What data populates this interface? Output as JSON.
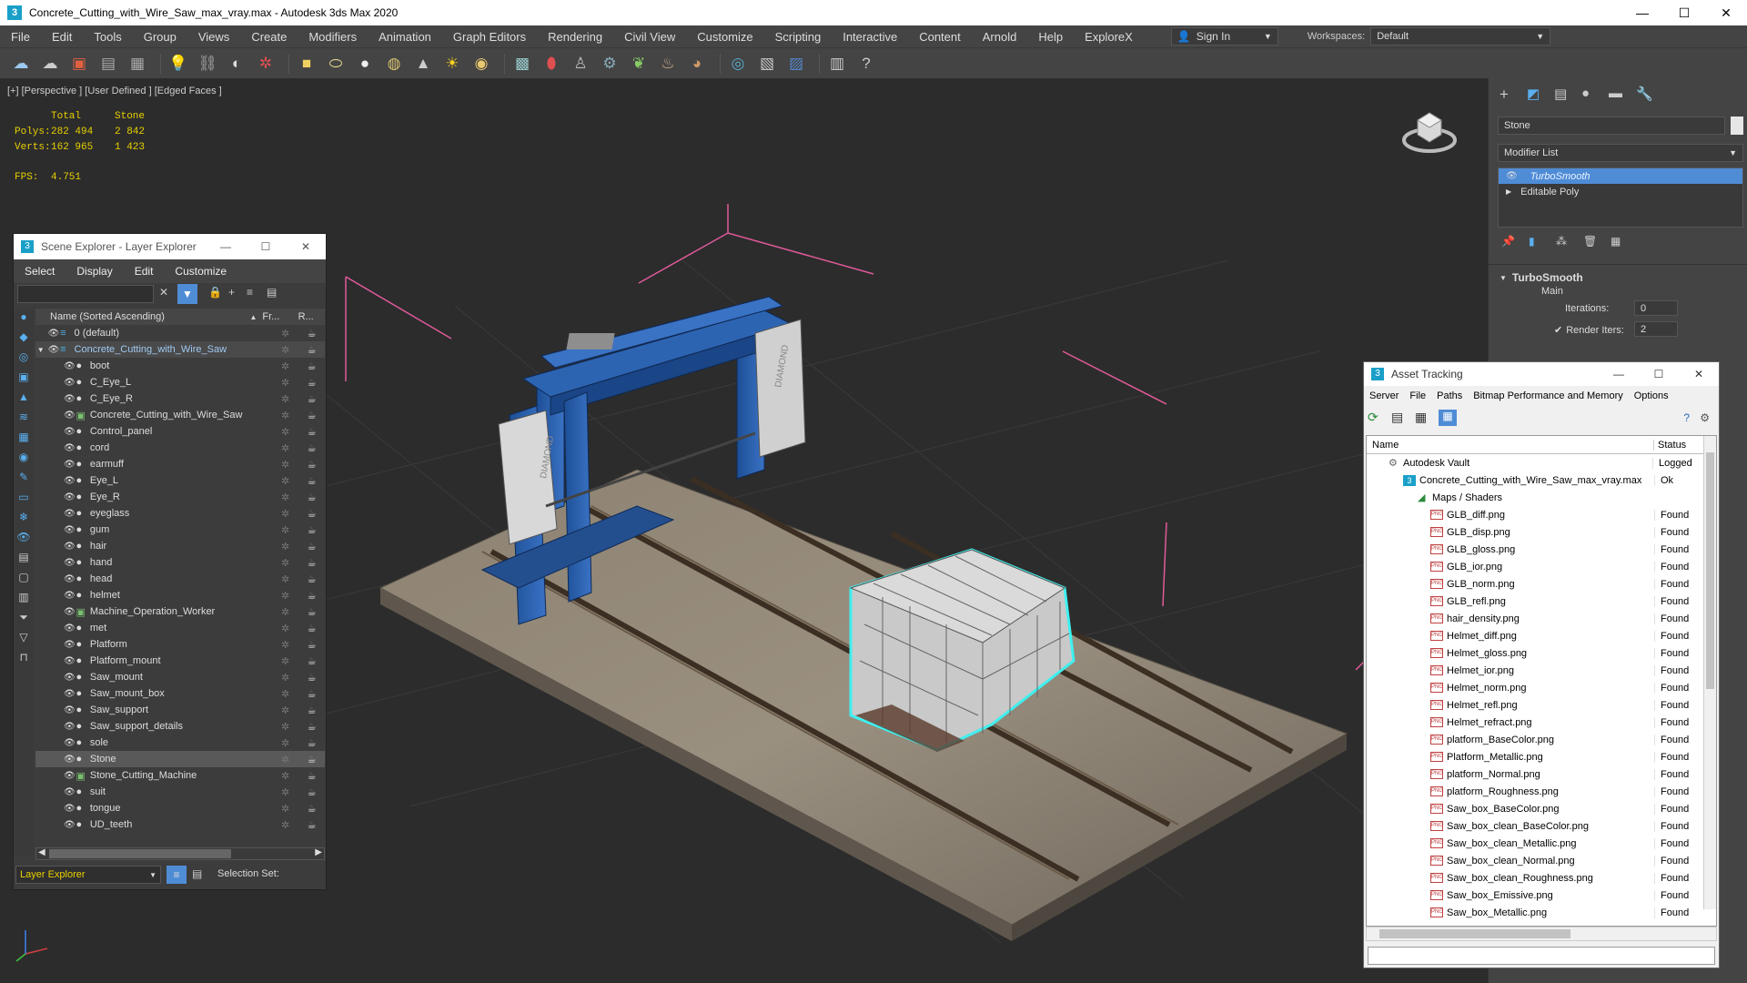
{
  "titlebar": {
    "app_icon": "3",
    "title": "Concrete_Cutting_with_Wire_Saw_max_vray.max - Autodesk 3ds Max 2020",
    "minimize": "—",
    "maximize": "☐",
    "close": "✕"
  },
  "menu": {
    "items": [
      "File",
      "Edit",
      "Tools",
      "Group",
      "Views",
      "Create",
      "Modifiers",
      "Animation",
      "Graph Editors",
      "Rendering",
      "Civil View",
      "Customize",
      "Scripting",
      "Interactive",
      "Content",
      "Arnold",
      "Help",
      "ExploreX"
    ],
    "sign_in": "Sign In",
    "workspaces_label": "Workspaces:",
    "workspace_value": "Default"
  },
  "viewport": {
    "label": "[+] [Perspective ] [User Defined ] [Edged Faces ]",
    "stats": {
      "col_total": "Total",
      "col_sel": "Stone",
      "polys_label": "Polys:",
      "polys_total": "282 494",
      "polys_sel": "2 842",
      "verts_label": "Verts:",
      "verts_total": "162 965",
      "verts_sel": "1 423",
      "fps_label": "FPS:",
      "fps_value": "4.751"
    },
    "machine_brand": "DIAMOND"
  },
  "command_panel": {
    "object_name": "Stone",
    "modifier_list": "Modifier List",
    "stack": [
      "TurboSmooth",
      "Editable Poly"
    ],
    "rollout_title": "TurboSmooth",
    "section_main": "Main",
    "iterations_label": "Iterations:",
    "iterations_value": "0",
    "render_iters_label": "Render Iters:",
    "render_iters_value": "2"
  },
  "scene_explorer": {
    "title": "Scene Explorer - Layer Explorer",
    "menu": [
      "Select",
      "Display",
      "Edit",
      "Customize"
    ],
    "col_name": "Name (Sorted Ascending)",
    "col_fr": "Fr...",
    "col_r": "R...",
    "rows": [
      {
        "name": "0 (default)",
        "level": 0,
        "type": "layer"
      },
      {
        "name": "Concrete_Cutting_with_Wire_Saw",
        "level": 0,
        "type": "layer-active"
      },
      {
        "name": "boot",
        "level": 1,
        "type": "obj"
      },
      {
        "name": "C_Eye_L",
        "level": 1,
        "type": "obj"
      },
      {
        "name": "C_Eye_R",
        "level": 1,
        "type": "obj"
      },
      {
        "name": "Concrete_Cutting_with_Wire_Saw",
        "level": 1,
        "type": "group"
      },
      {
        "name": "Control_panel",
        "level": 1,
        "type": "obj"
      },
      {
        "name": "cord",
        "level": 1,
        "type": "obj"
      },
      {
        "name": "earmuff",
        "level": 1,
        "type": "obj"
      },
      {
        "name": "Eye_L",
        "level": 1,
        "type": "obj"
      },
      {
        "name": "Eye_R",
        "level": 1,
        "type": "obj"
      },
      {
        "name": "eyeglass",
        "level": 1,
        "type": "obj"
      },
      {
        "name": "gum",
        "level": 1,
        "type": "obj"
      },
      {
        "name": "hair",
        "level": 1,
        "type": "obj"
      },
      {
        "name": "hand",
        "level": 1,
        "type": "obj"
      },
      {
        "name": "head",
        "level": 1,
        "type": "obj"
      },
      {
        "name": "helmet",
        "level": 1,
        "type": "obj"
      },
      {
        "name": "Machine_Operation_Worker",
        "level": 1,
        "type": "group"
      },
      {
        "name": "met",
        "level": 1,
        "type": "obj"
      },
      {
        "name": "Platform",
        "level": 1,
        "type": "obj"
      },
      {
        "name": "Platform_mount",
        "level": 1,
        "type": "obj"
      },
      {
        "name": "Saw_mount",
        "level": 1,
        "type": "obj"
      },
      {
        "name": "Saw_mount_box",
        "level": 1,
        "type": "obj"
      },
      {
        "name": "Saw_support",
        "level": 1,
        "type": "obj"
      },
      {
        "name": "Saw_support_details",
        "level": 1,
        "type": "obj"
      },
      {
        "name": "sole",
        "level": 1,
        "type": "obj"
      },
      {
        "name": "Stone",
        "level": 1,
        "type": "obj-selected"
      },
      {
        "name": "Stone_Cutting_Machine",
        "level": 1,
        "type": "group"
      },
      {
        "name": "suit",
        "level": 1,
        "type": "obj"
      },
      {
        "name": "tongue",
        "level": 1,
        "type": "obj"
      },
      {
        "name": "UD_teeth",
        "level": 1,
        "type": "obj"
      }
    ],
    "footer_explorer": "Layer Explorer",
    "selection_set_label": "Selection Set:"
  },
  "asset_tracking": {
    "title": "Asset Tracking",
    "menu": [
      "Server",
      "File",
      "Paths",
      "Bitmap Performance and Memory",
      "Options"
    ],
    "col_name": "Name",
    "col_status": "Status",
    "rows": [
      {
        "name": "Autodesk Vault",
        "status": "Logged",
        "level": 0,
        "icon": "vault"
      },
      {
        "name": "Concrete_Cutting_with_Wire_Saw_max_vray.max",
        "status": "Ok",
        "level": 1,
        "icon": "max"
      },
      {
        "name": "Maps / Shaders",
        "status": "",
        "level": 2,
        "icon": "maps"
      },
      {
        "name": "GLB_diff.png",
        "status": "Found",
        "level": 3,
        "icon": "png"
      },
      {
        "name": "GLB_disp.png",
        "status": "Found",
        "level": 3,
        "icon": "png"
      },
      {
        "name": "GLB_gloss.png",
        "status": "Found",
        "level": 3,
        "icon": "png"
      },
      {
        "name": "GLB_ior.png",
        "status": "Found",
        "level": 3,
        "icon": "png"
      },
      {
        "name": "GLB_norm.png",
        "status": "Found",
        "level": 3,
        "icon": "png"
      },
      {
        "name": "GLB_refl.png",
        "status": "Found",
        "level": 3,
        "icon": "png"
      },
      {
        "name": "hair_density.png",
        "status": "Found",
        "level": 3,
        "icon": "png"
      },
      {
        "name": "Helmet_diff.png",
        "status": "Found",
        "level": 3,
        "icon": "png"
      },
      {
        "name": "Helmet_gloss.png",
        "status": "Found",
        "level": 3,
        "icon": "png"
      },
      {
        "name": "Helmet_ior.png",
        "status": "Found",
        "level": 3,
        "icon": "png"
      },
      {
        "name": "Helmet_norm.png",
        "status": "Found",
        "level": 3,
        "icon": "png"
      },
      {
        "name": "Helmet_refl.png",
        "status": "Found",
        "level": 3,
        "icon": "png"
      },
      {
        "name": "Helmet_refract.png",
        "status": "Found",
        "level": 3,
        "icon": "png"
      },
      {
        "name": "platform_BaseColor.png",
        "status": "Found",
        "level": 3,
        "icon": "png"
      },
      {
        "name": "Platform_Metallic.png",
        "status": "Found",
        "level": 3,
        "icon": "png"
      },
      {
        "name": "platform_Normal.png",
        "status": "Found",
        "level": 3,
        "icon": "png"
      },
      {
        "name": "platform_Roughness.png",
        "status": "Found",
        "level": 3,
        "icon": "png"
      },
      {
        "name": "Saw_box_BaseColor.png",
        "status": "Found",
        "level": 3,
        "icon": "png"
      },
      {
        "name": "Saw_box_clean_BaseColor.png",
        "status": "Found",
        "level": 3,
        "icon": "png"
      },
      {
        "name": "Saw_box_clean_Metallic.png",
        "status": "Found",
        "level": 3,
        "icon": "png"
      },
      {
        "name": "Saw_box_clean_Normal.png",
        "status": "Found",
        "level": 3,
        "icon": "png"
      },
      {
        "name": "Saw_box_clean_Roughness.png",
        "status": "Found",
        "level": 3,
        "icon": "png"
      },
      {
        "name": "Saw_box_Emissive.png",
        "status": "Found",
        "level": 3,
        "icon": "png"
      },
      {
        "name": "Saw_box_Metallic.png",
        "status": "Found",
        "level": 3,
        "icon": "png"
      }
    ]
  },
  "colors": {
    "accent_blue": "#4f8cd6",
    "stats_yellow": "#e8d000",
    "selection_cyan": "#3ff0f0",
    "bbox_pink": "#e05a9a"
  }
}
